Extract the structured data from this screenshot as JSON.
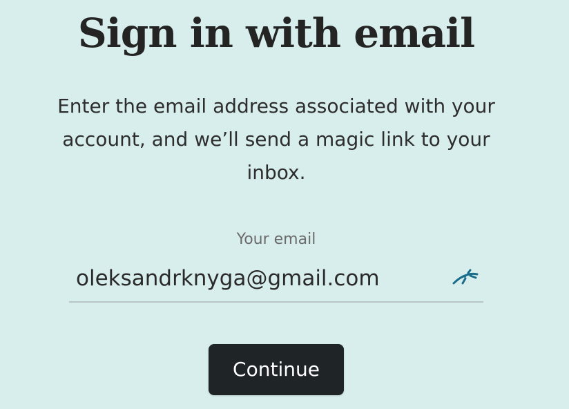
{
  "page": {
    "title": "Sign in with email",
    "description": "Enter the email address associated with your account, and we’ll send a magic link to your inbox."
  },
  "email_field": {
    "label": "Your email",
    "value": "oleksandrknyga@gmail.com",
    "icon": "password-manager-autofill-icon"
  },
  "actions": {
    "continue_label": "Continue"
  },
  "colors": {
    "background": "#d8eeec",
    "text": "#242424",
    "muted_text": "#6b6b6b",
    "input_border": "#b7c6c4",
    "button_background": "#1f2426",
    "button_text": "#ffffff",
    "icon_accent": "#1a6d8a"
  }
}
